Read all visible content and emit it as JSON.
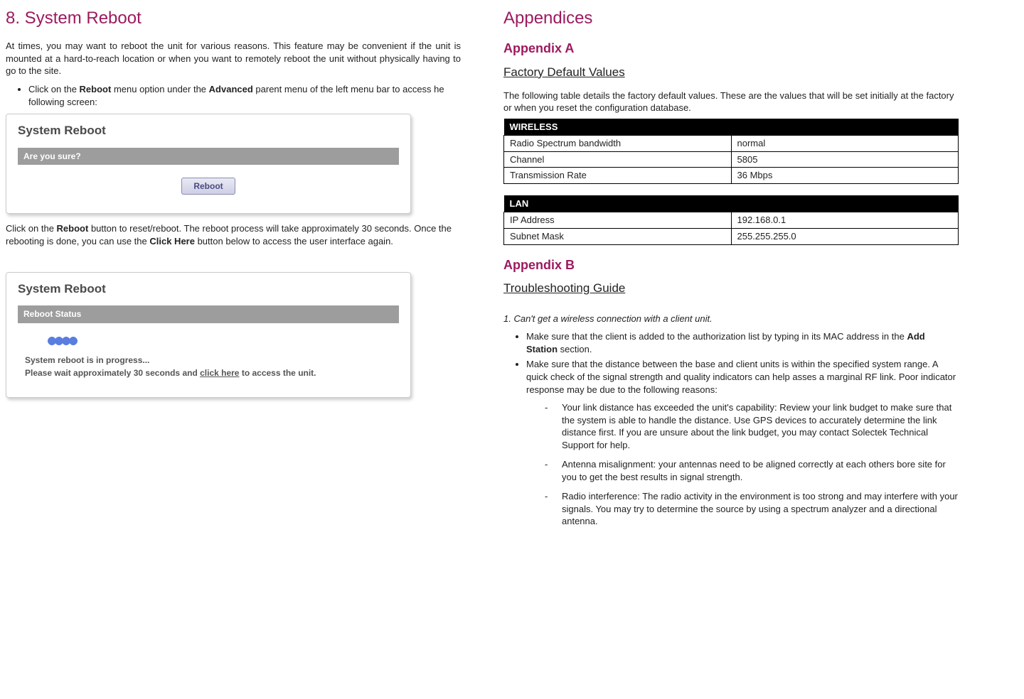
{
  "left": {
    "heading": "8. System Reboot",
    "intro": "At times, you may want to reboot the unit for various reasons. This feature may be convenient if the unit is mounted at a hard-to-reach location or when you want to remotely reboot the unit without physically having to go to the site.",
    "bullet1_a": "Click on the ",
    "bullet1_b": "Reboot",
    "bullet1_c": " menu option under the ",
    "bullet1_d": "Advanced",
    "bullet1_e": " parent menu of the left menu bar to access he following screen:",
    "panel1_title": "System Reboot",
    "panel1_bar": "Are you sure?",
    "panel1_button": "Reboot",
    "after1_a": "Click on the ",
    "after1_b": "Reboot",
    "after1_c": " button to reset/reboot. The reboot process will take approximately 30 seconds. Once the rebooting is done, you can use the ",
    "after1_d": "Click Here",
    "after1_e": " button below to access the user interface again.",
    "panel2_title": "System Reboot",
    "panel2_bar": "Reboot Status",
    "panel2_msg1": "System reboot is in progress...",
    "panel2_msg2a": "Please wait approximately 30 seconds and ",
    "panel2_msg2b": "click here",
    "panel2_msg2c": " to access the unit."
  },
  "right": {
    "heading": "Appendices",
    "appA": "Appendix A",
    "appA_sub": "Factory Default Values",
    "appA_intro": "The following table details the factory default values. These are the values that will be set initially at the factory or when you reset the configuration database.",
    "tableWireless": {
      "header": "WIRELESS",
      "rows": [
        {
          "k": "Radio Spectrum bandwidth",
          "v": "normal"
        },
        {
          "k": "Channel",
          "v": "5805"
        },
        {
          "k": "Transmission Rate",
          "v": "36 Mbps"
        }
      ]
    },
    "tableLan": {
      "header": "LAN",
      "rows": [
        {
          "k": "IP Address",
          "v": "192.168.0.1"
        },
        {
          "k": "Subnet Mask",
          "v": "255.255.255.0"
        }
      ]
    },
    "appB": "Appendix B",
    "appB_sub": "Troubleshooting Guide",
    "q1": "1. Can't get a wireless connection with a client unit.",
    "b1_a": "Make sure that the client is added to the authorization list by typing in its MAC address in the ",
    "b1_b": "Add Station",
    "b1_c": " section.",
    "b2": "Make sure that the distance between the base and client units is within the specified system range.  A quick check of the signal strength and quality indicators can help asses a marginal RF link.  Poor indicator response may be due to the following reasons:",
    "d1": "Your link distance has exceeded the unit's capability: Review your link budget to make sure that the system is able to handle the distance. Use GPS devices to accurately determine the link distance first. If you are unsure about the link budget, you may contact Solectek Technical Support for help.",
    "d2": "Antenna misalignment: your antennas need to be aligned correctly at each others bore site for you to get the best results in signal strength.",
    "d3": "Radio interference: The radio activity in the environment is too strong and may interfere with your signals. You may try to determine the source by using a spectrum analyzer and a directional antenna."
  }
}
